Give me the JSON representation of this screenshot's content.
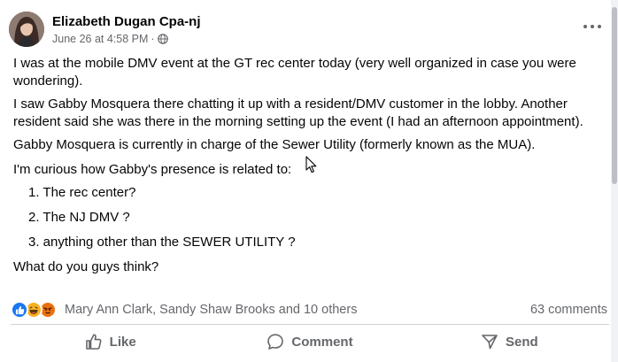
{
  "post": {
    "author": "Elizabeth Dugan Cpa-nj",
    "timestamp": "June 26 at 4:58 PM",
    "separator": "·",
    "audience_icon": "globe-icon",
    "more_icon": "more-options-icon",
    "paragraphs": [
      "I was at the mobile DMV event at the GT rec center today (very well organized in case you were wondering).",
      "I saw Gabby Mosquera there chatting it up with a resident/DMV customer in the lobby. Another resident said she was there in the morning setting up the event (I had an afternoon appointment).",
      "Gabby Mosquera is currently in charge of the Sewer Utility (formerly known as the MUA).",
      "I'm curious how Gabby's presence is related to:"
    ],
    "list": [
      "1. The rec center?",
      "2. The NJ DMV ?",
      "3. anything other than the SEWER UTILITY ?"
    ],
    "closing": "What do you guys think?"
  },
  "reactions": {
    "icons": [
      "like-icon",
      "haha-icon",
      "angry-icon"
    ],
    "names": "Mary Ann Clark, Sandy Shaw Brooks and 10 others",
    "comments": "63 comments"
  },
  "actions": {
    "like": "Like",
    "comment": "Comment",
    "send": "Send"
  },
  "colors": {
    "text": "#050505",
    "secondary": "#65676b",
    "like_blue": "#1877f2",
    "haha_yellow": "#f7b125",
    "angry_orange": "#e9710f",
    "divider": "#ced0d4"
  }
}
